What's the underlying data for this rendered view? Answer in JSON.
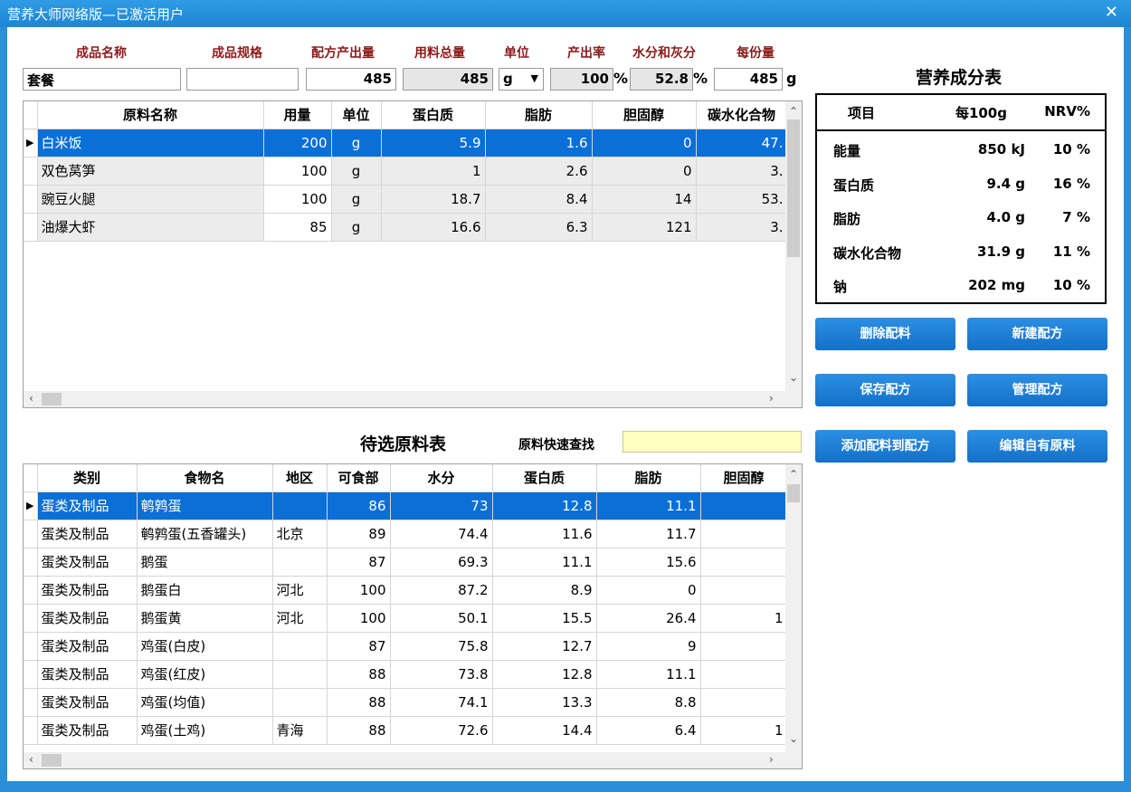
{
  "window": {
    "title": "营养大师网络版—已激活用户",
    "close_glyph": "✕"
  },
  "header": {
    "labels": {
      "product_name": "成品名称",
      "spec": "成品规格",
      "output": "配方产出量",
      "total": "用料总量",
      "unit": "单位",
      "yield": "产出率",
      "water_ash": "水分和灰分",
      "per_serving": "每份量"
    },
    "values": {
      "product_name": "套餐",
      "spec": "",
      "output": "485",
      "total": "485",
      "unit": "g",
      "yield": "100",
      "yield_unit": "%",
      "water_ash": "52.8",
      "water_ash_unit": "%",
      "per_serving": "485",
      "per_serving_unit": "g"
    }
  },
  "recipe_grid": {
    "columns": [
      "原料名称",
      "用量",
      "单位",
      "蛋白质",
      "脂肪",
      "胆固醇",
      "碳水化合物"
    ],
    "rows": [
      [
        "白米饭",
        "200",
        "g",
        "5.9",
        "1.6",
        "0",
        "47."
      ],
      [
        "双色莴笋",
        "100",
        "g",
        "1",
        "2.6",
        "0",
        "3."
      ],
      [
        "豌豆火腿",
        "100",
        "g",
        "18.7",
        "8.4",
        "14",
        "53."
      ],
      [
        "油爆大虾",
        "85",
        "g",
        "16.6",
        "6.3",
        "121",
        "3."
      ]
    ],
    "selected_row": 0
  },
  "nutrition": {
    "title": "营养成分表",
    "headers": [
      "项目",
      "每100g",
      "NRV%"
    ],
    "rows": [
      [
        "能量",
        "850 kJ",
        "10 %"
      ],
      [
        "蛋白质",
        "9.4 g",
        "16 %"
      ],
      [
        "脂肪",
        "4.0 g",
        "7 %"
      ],
      [
        "碳水化合物",
        "31.9 g",
        "11 %"
      ],
      [
        "钠",
        "202 mg",
        "10 %"
      ]
    ]
  },
  "buttons": {
    "delete_ingredient": "删除配料",
    "new_recipe": "新建配方",
    "save_recipe": "保存配方",
    "manage_recipe": "管理配方",
    "add_to_recipe": "添加配料到配方",
    "edit_own": "编辑自有原料"
  },
  "ingredients": {
    "title": "待选原料表",
    "search_label": "原料快速查找",
    "search_value": "",
    "columns": [
      "类别",
      "食物名",
      "地区",
      "可食部",
      "水分",
      "蛋白质",
      "脂肪",
      "胆固醇"
    ],
    "rows": [
      [
        "蛋类及制品",
        "鹌鹑蛋",
        "",
        "86",
        "73",
        "12.8",
        "11.1",
        ""
      ],
      [
        "蛋类及制品",
        "鹌鹑蛋(五香罐头)",
        "北京",
        "89",
        "74.4",
        "11.6",
        "11.7",
        ""
      ],
      [
        "蛋类及制品",
        "鹅蛋",
        "",
        "87",
        "69.3",
        "11.1",
        "15.6",
        ""
      ],
      [
        "蛋类及制品",
        "鹅蛋白",
        "河北",
        "100",
        "87.2",
        "8.9",
        "0",
        ""
      ],
      [
        "蛋类及制品",
        "鹅蛋黄",
        "河北",
        "100",
        "50.1",
        "15.5",
        "26.4",
        "1"
      ],
      [
        "蛋类及制品",
        "鸡蛋(白皮)",
        "",
        "87",
        "75.8",
        "12.7",
        "9",
        ""
      ],
      [
        "蛋类及制品",
        "鸡蛋(红皮)",
        "",
        "88",
        "73.8",
        "12.8",
        "11.1",
        ""
      ],
      [
        "蛋类及制品",
        "鸡蛋(均值)",
        "",
        "88",
        "74.1",
        "13.3",
        "8.8",
        ""
      ],
      [
        "蛋类及制品",
        "鸡蛋(土鸡)",
        "青海",
        "88",
        "72.6",
        "14.4",
        "6.4",
        "1"
      ]
    ],
    "selected_row": 0
  },
  "glyphs": {
    "row_indicator": "▶",
    "arrow_up": "⌃",
    "arrow_down": "⌄",
    "arrow_left": "‹",
    "arrow_right": "›",
    "dropdown": "▼"
  }
}
